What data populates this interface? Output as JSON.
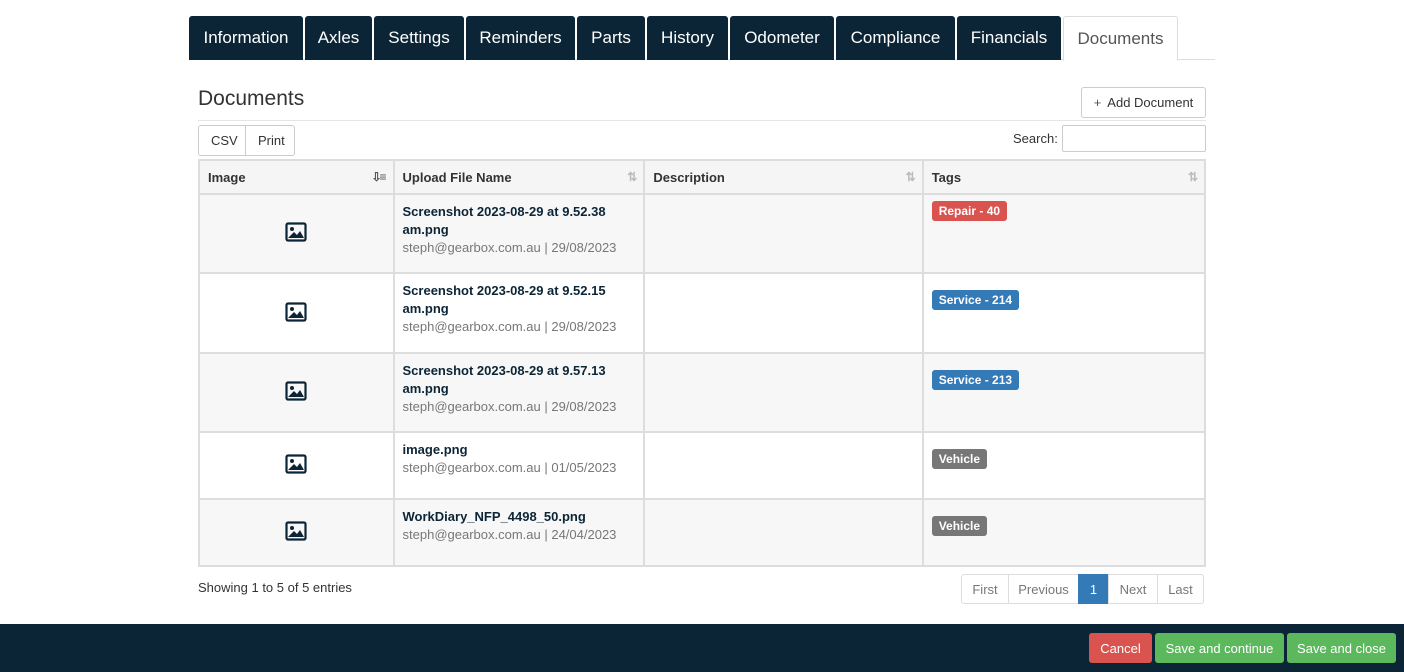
{
  "tabs": [
    "Information",
    "Axles",
    "Settings",
    "Reminders",
    "Parts",
    "History",
    "Odometer",
    "Compliance",
    "Financials",
    "Documents"
  ],
  "active_tab": "Documents",
  "section_title": "Documents",
  "add_document_label": "Add Document",
  "export_buttons": {
    "csv": "CSV",
    "print": "Print"
  },
  "search": {
    "label": "Search:",
    "value": ""
  },
  "table": {
    "headers": [
      "Image",
      "Upload File Name",
      "Description",
      "Tags"
    ],
    "rows": [
      {
        "file_name": "Screenshot 2023-08-29 at 9.52.38 am.png",
        "meta": "steph@gearbox.com.au | 29/08/2023",
        "description": "",
        "tag": "Repair - 40",
        "tag_color": "#d9534f"
      },
      {
        "file_name": "Screenshot 2023-08-29 at 9.52.15 am.png",
        "meta": "steph@gearbox.com.au | 29/08/2023",
        "description": "",
        "tag": "Service - 214",
        "tag_color": "#337ab7"
      },
      {
        "file_name": "Screenshot 2023-08-29 at 9.57.13 am.png",
        "meta": "steph@gearbox.com.au | 29/08/2023",
        "description": "",
        "tag": "Service - 213",
        "tag_color": "#337ab7"
      },
      {
        "file_name": "image.png",
        "meta": "steph@gearbox.com.au | 01/05/2023",
        "description": "",
        "tag": "Vehicle",
        "tag_color": "#777777"
      },
      {
        "file_name": "WorkDiary_NFP_4498_50.png",
        "meta": "steph@gearbox.com.au | 24/04/2023",
        "description": "",
        "tag": "Vehicle",
        "tag_color": "#777777"
      }
    ]
  },
  "info": "Showing 1 to 5 of 5 entries",
  "pagination": {
    "first": "First",
    "previous": "Previous",
    "current": "1",
    "next": "Next",
    "last": "Last"
  },
  "footer": {
    "cancel": "Cancel",
    "save_continue": "Save and continue",
    "save_close": "Save and close"
  },
  "colors": {
    "navy": "#0c2536",
    "cancel": "#d9534f",
    "save": "#5cb85c",
    "primary": "#337ab7"
  }
}
